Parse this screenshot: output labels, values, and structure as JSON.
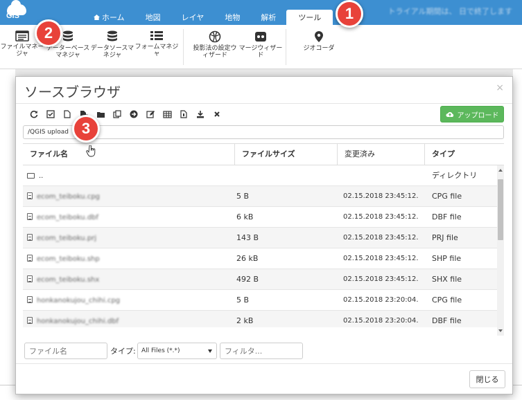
{
  "app": {
    "logo_text": "GIS",
    "trial_text": "トライアル期間は、 日で終了します"
  },
  "nav": {
    "tabs": [
      {
        "label": "ホーム",
        "active": false
      },
      {
        "label": "地図",
        "active": false
      },
      {
        "label": "レイヤ",
        "active": false
      },
      {
        "label": "地物",
        "active": false
      },
      {
        "label": "解析",
        "active": false
      },
      {
        "label": "ツール",
        "active": true
      }
    ]
  },
  "ribbon": {
    "items": [
      {
        "label": "ファイルマネージャ",
        "icon": "file-manager-icon"
      },
      {
        "label": "データーベースマネジャ",
        "icon": "database-icon"
      },
      {
        "label": "データソースマネジャ",
        "icon": "datasource-icon"
      },
      {
        "label": "フォームマネジャ",
        "icon": "form-manager-icon"
      },
      {
        "label": "投影法の設定ウィザード",
        "icon": "globe-icon"
      },
      {
        "label": "マージウィザード",
        "icon": "merge-icon"
      },
      {
        "label": "ジオコーダ",
        "icon": "map-pin-icon"
      }
    ]
  },
  "modal": {
    "title": "ソースブラウザ",
    "close_glyph": "×",
    "upload_label": "アップロード",
    "path": "/QGIS upload",
    "columns": {
      "name": "ファイル名",
      "size": "ファイルサイズ",
      "modified": "変更済み",
      "type": "タイプ"
    },
    "rows": [
      {
        "name": "..",
        "size": "",
        "modified": "",
        "type": "ディレクトリ",
        "is_dir": true
      },
      {
        "name": "ecom_teiboku.cpg",
        "size": "5 B",
        "modified": "02.15.2018 23:45:12.",
        "type": "CPG file"
      },
      {
        "name": "ecom_teiboku.dbf",
        "size": "6 kB",
        "modified": "02.15.2018 23:45:12.",
        "type": "DBF file"
      },
      {
        "name": "ecom_teiboku.prj",
        "size": "143 B",
        "modified": "02.15.2018 23:45:12.",
        "type": "PRJ file"
      },
      {
        "name": "ecom_teiboku.shp",
        "size": "26 kB",
        "modified": "02.15.2018 23:45:12.",
        "type": "SHP file"
      },
      {
        "name": "ecom_teiboku.shx",
        "size": "492 B",
        "modified": "02.15.2018 23:45:12.",
        "type": "SHX file"
      },
      {
        "name": "honkanokujou_chihi.cpg",
        "size": "5 B",
        "modified": "02.15.2018 23:20:04.",
        "type": "CPG file"
      },
      {
        "name": "honkanokujou_chihi.dbf",
        "size": "2 kB",
        "modified": "02.15.2018 23:20:04.",
        "type": "DBF file"
      }
    ],
    "filename_placeholder": "ファイル名",
    "type_label": "タイプ:",
    "type_value": "All Files (*.*)",
    "filter_placeholder": "フィルタ...",
    "close_label": "閉じる"
  },
  "badges": [
    "1",
    "2",
    "3"
  ],
  "colors": {
    "topbar": "#3d8fd1",
    "upload": "#5cb85c",
    "badge": "#e8423a"
  }
}
